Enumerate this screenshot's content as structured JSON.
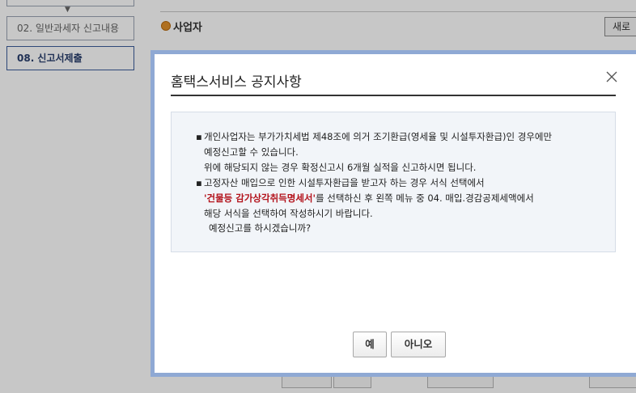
{
  "sidebar": {
    "items": [
      {
        "label": ""
      },
      {
        "label": "02. 일반과세자 신고내용"
      },
      {
        "label": "08. 신고서제출"
      }
    ]
  },
  "main": {
    "section_title": "사업자",
    "new_button": "새로"
  },
  "dialog": {
    "title": "홈택스서비스 공지사항",
    "notices": [
      {
        "line1": "개인사업자는 부가가치세법 제48조에 의거 조기환급(영세율 및 시설투자환급)인 경우에만",
        "line2": "예정신고할 수 있습니다.",
        "line3": "위에 해당되지 않는 경우 확정신고시 6개월 실적을 신고하시면 됩니다."
      },
      {
        "line1": "고정자산 매입으로 인한 시설투자환급을 받고자 하는 경우 서식 선택에서",
        "highlight": "'건물등 감가상각취득명세서'",
        "line2_rest": "를 선택하신 후 왼쪽 메뉴 중 04. 매입.경감공제세액에서",
        "line3": "해당 서식을 선택하여 작성하시기 바랍니다."
      }
    ],
    "question": "예정신고를 하시겠습니까?",
    "yes_label": "예",
    "no_label": "아니오"
  },
  "colors": {
    "dialog_border": "#8fa9d4",
    "highlight": "#b3121b",
    "notice_bg": "#f2f5f9"
  }
}
